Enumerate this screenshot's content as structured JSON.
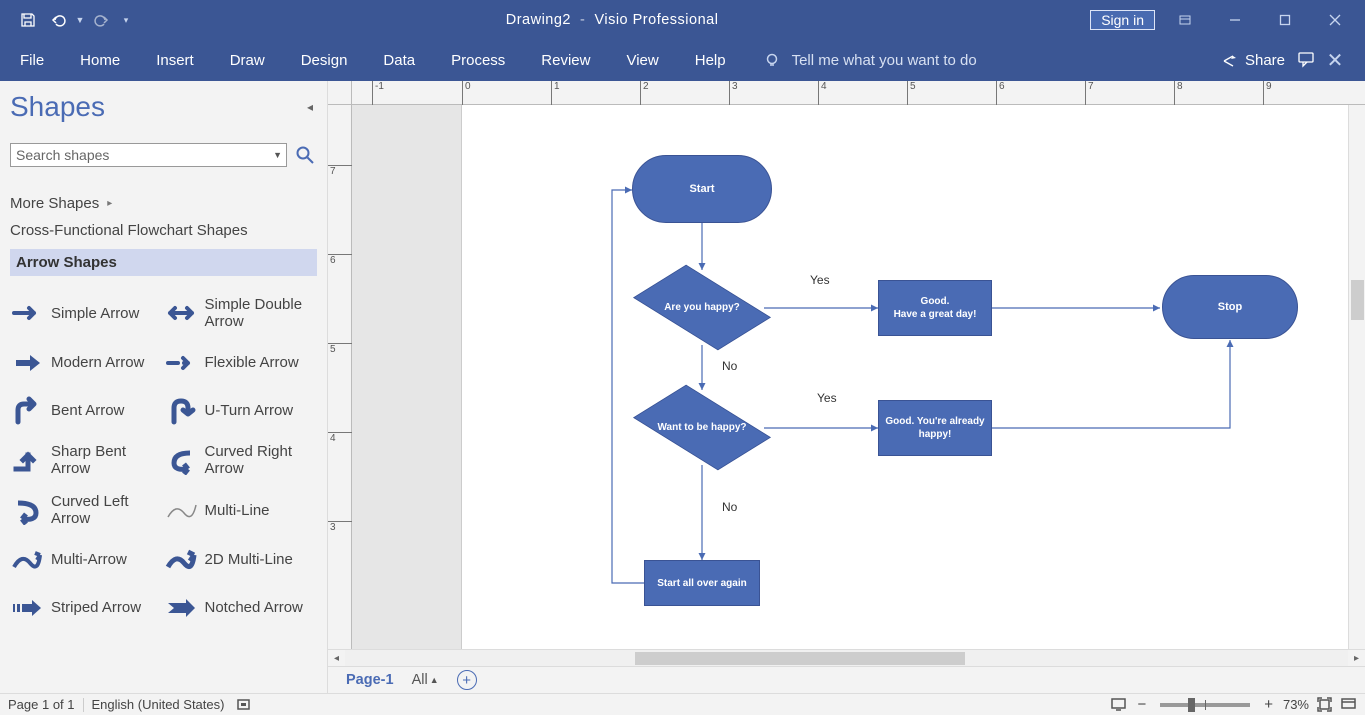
{
  "titlebar": {
    "doc_name": "Drawing2",
    "app_name": "Visio Professional",
    "signin": "Sign in"
  },
  "ribbon": {
    "tabs": [
      "File",
      "Home",
      "Insert",
      "Draw",
      "Design",
      "Data",
      "Process",
      "Review",
      "View",
      "Help"
    ],
    "tellme": "Tell me what you want to do",
    "share": "Share"
  },
  "shapes_pane": {
    "title": "Shapes",
    "search_placeholder": "Search shapes",
    "more_shapes": "More Shapes",
    "categories": [
      "Cross-Functional Flowchart Shapes",
      "Arrow Shapes"
    ],
    "active_cat": 1,
    "items": [
      {
        "label": "Simple Arrow",
        "icon": "sa"
      },
      {
        "label": "Simple Double Arrow",
        "icon": "sda"
      },
      {
        "label": "Modern Arrow",
        "icon": "ma"
      },
      {
        "label": "Flexible Arrow",
        "icon": "fa"
      },
      {
        "label": "Bent Arrow",
        "icon": "ba"
      },
      {
        "label": "U-Turn Arrow",
        "icon": "ua"
      },
      {
        "label": "Sharp Bent Arrow",
        "icon": "sba"
      },
      {
        "label": "Curved Right Arrow",
        "icon": "cra"
      },
      {
        "label": "Curved Left Arrow",
        "icon": "cla"
      },
      {
        "label": "Multi-Line",
        "icon": "ml"
      },
      {
        "label": "Multi-Arrow",
        "icon": "maw"
      },
      {
        "label": "2D Multi-Line",
        "icon": "ml2"
      },
      {
        "label": "Striped Arrow",
        "icon": "sta"
      },
      {
        "label": "Notched Arrow",
        "icon": "na"
      }
    ]
  },
  "hruler_ticks": [
    "-1",
    "0",
    "1",
    "2",
    "3",
    "4",
    "5",
    "6",
    "7",
    "8",
    "9"
  ],
  "vruler_ticks": [
    "7",
    "6",
    "5",
    "4",
    "3"
  ],
  "flowchart": {
    "start": "Start",
    "decision1": "Are you happy?",
    "dec1_yes": "Yes",
    "dec1_no": "No",
    "proc1_l1": "Good.",
    "proc1_l2": "Have a great day!",
    "stop": "Stop",
    "decision2": "Want to be happy?",
    "dec2_yes": "Yes",
    "dec2_no": "No",
    "proc2_l1": "Good. You're already",
    "proc2_l2": "happy!",
    "proc3": "Start all over again"
  },
  "pagetabs": {
    "page": "Page-1",
    "all": "All"
  },
  "statusbar": {
    "pages": "Page 1 of 1",
    "lang": "English (United States)",
    "zoom": "73%"
  }
}
